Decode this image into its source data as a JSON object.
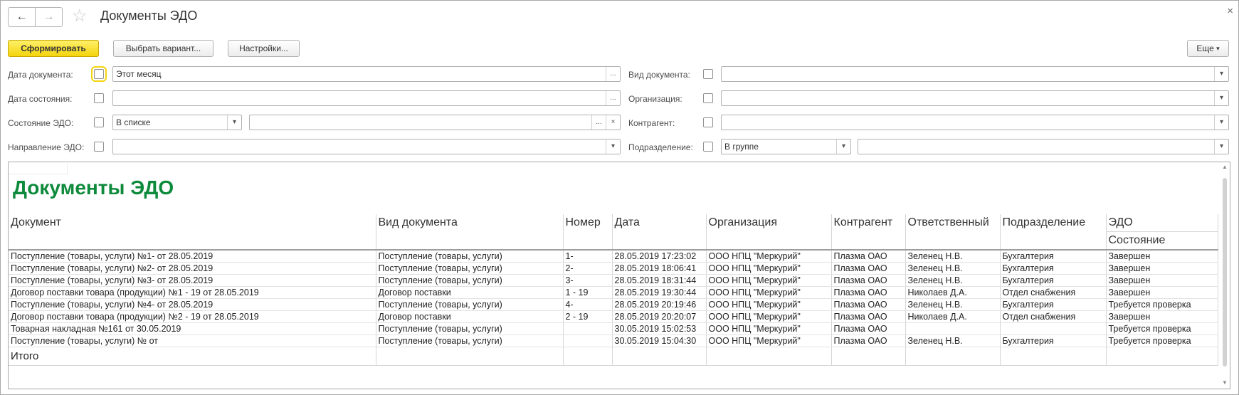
{
  "window": {
    "title": "Документы ЭДО"
  },
  "nav": {
    "back_icon": "←",
    "forward_icon": "→",
    "favorite_icon": "☆",
    "close_icon": "×"
  },
  "toolbar": {
    "generate_label": "Сформировать",
    "choose_variant_label": "Выбрать вариант...",
    "settings_label": "Настройки...",
    "more_label": "Еще",
    "more_icon": "▾"
  },
  "filters": {
    "doc_date_label": "Дата документа:",
    "doc_date_value": "Этот месяц",
    "state_date_label": "Дата состояния:",
    "state_date_value": "",
    "edo_state_label": "Состояние ЭДО:",
    "edo_state_mode": "В списке",
    "edo_state_value": "",
    "direction_label": "Направление ЭДО:",
    "direction_value": "",
    "doc_type_label": "Вид документа:",
    "doc_type_value": "",
    "org_label": "Организация:",
    "org_value": "",
    "counterparty_label": "Контрагент:",
    "counterparty_value": "",
    "division_label": "Подразделение:",
    "division_mode": "В группе",
    "division_value": "",
    "ellipsis": "...",
    "clear": "×",
    "dropdown": "▾"
  },
  "report": {
    "title": "Документы ЭДО",
    "columns": [
      "Документ",
      "Вид документа",
      "Номер",
      "Дата",
      "Организация",
      "Контрагент",
      "Ответственный",
      "Подразделение",
      "ЭДО"
    ],
    "sub_column": "Состояние",
    "rows": [
      [
        "Поступление (товары, услуги) №1- от 28.05.2019",
        "Поступление (товары, услуги)",
        "1-",
        "28.05.2019 17:23:02",
        "ООО НПЦ \"Меркурий\"",
        "Плазма ОАО",
        "Зеленец Н.В.",
        "Бухгалтерия",
        "Завершен"
      ],
      [
        "Поступление (товары, услуги) №2- от 28.05.2019",
        "Поступление (товары, услуги)",
        "2-",
        "28.05.2019 18:06:41",
        "ООО НПЦ \"Меркурий\"",
        "Плазма ОАО",
        "Зеленец Н.В.",
        "Бухгалтерия",
        "Завершен"
      ],
      [
        "Поступление (товары, услуги) №3- от 28.05.2019",
        "Поступление (товары, услуги)",
        "3-",
        "28.05.2019 18:31:44",
        "ООО НПЦ \"Меркурий\"",
        "Плазма ОАО",
        "Зеленец Н.В.",
        "Бухгалтерия",
        "Завершен"
      ],
      [
        "Договор поставки товара (продукции) №1 - 19 от 28.05.2019",
        "Договор поставки",
        "1 - 19",
        "28.05.2019 19:30:44",
        "ООО НПЦ \"Меркурий\"",
        "Плазма ОАО",
        "Николаев Д.А.",
        "Отдел снабжения",
        "Завершен"
      ],
      [
        "Поступление (товары, услуги) №4- от 28.05.2019",
        "Поступление (товары, услуги)",
        "4-",
        "28.05.2019 20:19:46",
        "ООО НПЦ \"Меркурий\"",
        "Плазма ОАО",
        "Зеленец Н.В.",
        "Бухгалтерия",
        "Требуется проверка"
      ],
      [
        "Договор поставки товара (продукции) №2 - 19 от 28.05.2019",
        "Договор поставки",
        "2 - 19",
        "28.05.2019 20:20:07",
        "ООО НПЦ \"Меркурий\"",
        "Плазма ОАО",
        "Николаев Д.А.",
        "Отдел снабжения",
        "Завершен"
      ],
      [
        "Товарная накладная №161 от 30.05.2019",
        "Поступление (товары, услуги)",
        "",
        "30.05.2019 15:02:53",
        "ООО НПЦ \"Меркурий\"",
        "Плазма ОАО",
        "",
        "",
        "Требуется проверка"
      ],
      [
        "Поступление (товары, услуги) № от",
        "Поступление (товары, услуги)",
        "",
        "30.05.2019 15:04:30",
        "ООО НПЦ \"Меркурий\"",
        "Плазма ОАО",
        "Зеленец Н.В.",
        "Бухгалтерия",
        "Требуется проверка"
      ]
    ],
    "total_label": "Итого"
  },
  "colors": {
    "accent_yellow": "#f4d40d",
    "title_green": "#0d8a3b"
  }
}
